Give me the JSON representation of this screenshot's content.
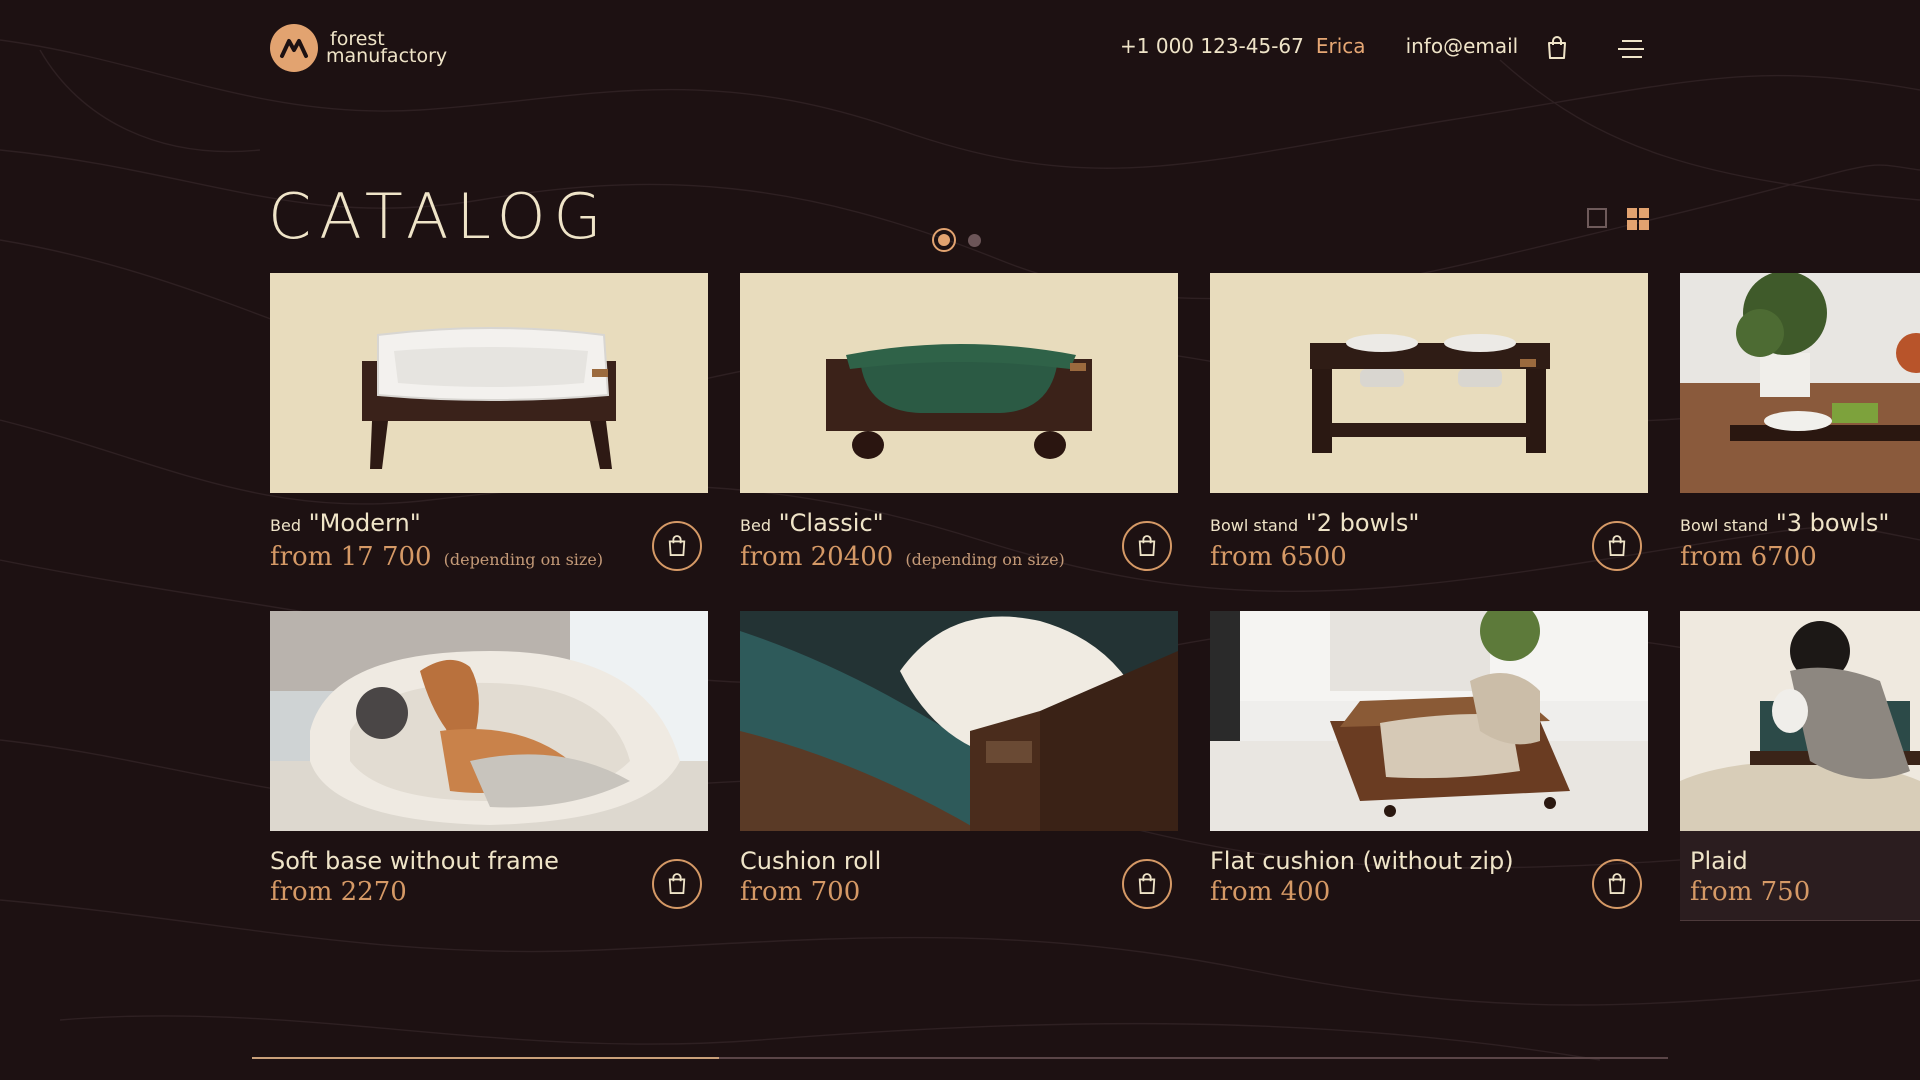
{
  "brand": {
    "line1": "forest",
    "line2": "manufactory"
  },
  "header": {
    "phone": "+1 000 123-45-67",
    "user": "Erica",
    "email": "info@email"
  },
  "catalog": {
    "title": "CATALOG",
    "pager": {
      "current": 1,
      "total": 2
    },
    "products": [
      {
        "type": "Bed",
        "name": "\"Modern\"",
        "price": "from 17 700",
        "note": "(depending on size)"
      },
      {
        "type": "Bed",
        "name": "\"Classic\"",
        "price": "from 20400",
        "note": "(depending on size)"
      },
      {
        "type": "Bowl stand",
        "name": "\"2 bowls\"",
        "price": "from 6500",
        "note": ""
      },
      {
        "type": "Bowl stand",
        "name": "\"3 bowls\"",
        "price": "from 6700",
        "note": ""
      },
      {
        "type": "",
        "name": "Soft base without frame",
        "price": "from 2270",
        "note": ""
      },
      {
        "type": "",
        "name": "Cushion roll",
        "price": "from 700",
        "note": ""
      },
      {
        "type": "",
        "name": "Flat cushion (without zip)",
        "price": "from 400",
        "note": ""
      },
      {
        "type": "",
        "name": "Plaid",
        "price": "from 750",
        "note": ""
      }
    ]
  },
  "scroll_progress": 0.33,
  "colors": {
    "background": "#1d1112",
    "accent": "#e2a370",
    "text": "#efe4c8",
    "price": "#d59966",
    "card_beige": "#e8dcbd"
  },
  "icons": [
    "logo-mark",
    "shopping-bag-icon",
    "menu-icon",
    "single-view-icon",
    "grid-view-icon"
  ]
}
